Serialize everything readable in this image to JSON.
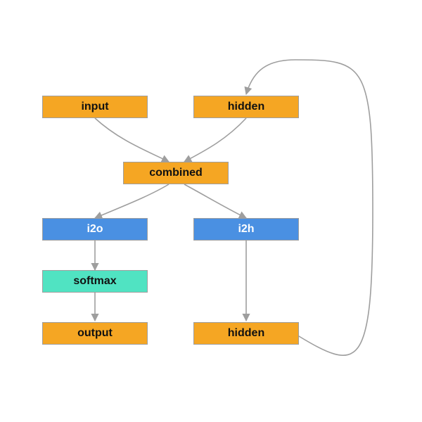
{
  "colors": {
    "orange": "#f5a623",
    "blue": "#4a90e2",
    "teal": "#50e3c2",
    "edge": "#9e9e9e"
  },
  "nodes": {
    "input": {
      "label": "input"
    },
    "hidden_top": {
      "label": "hidden"
    },
    "combined": {
      "label": "combined"
    },
    "i2o": {
      "label": "i2o"
    },
    "i2h": {
      "label": "i2h"
    },
    "softmax": {
      "label": "softmax"
    },
    "output": {
      "label": "output"
    },
    "hidden_bottom": {
      "label": "hidden"
    }
  },
  "edges": [
    {
      "from": "input",
      "to": "combined"
    },
    {
      "from": "hidden_top",
      "to": "combined"
    },
    {
      "from": "combined",
      "to": "i2o"
    },
    {
      "from": "combined",
      "to": "i2h"
    },
    {
      "from": "i2o",
      "to": "softmax"
    },
    {
      "from": "softmax",
      "to": "output"
    },
    {
      "from": "i2h",
      "to": "hidden_bottom"
    },
    {
      "from": "hidden_bottom",
      "to": "hidden_top",
      "loop": true
    }
  ]
}
